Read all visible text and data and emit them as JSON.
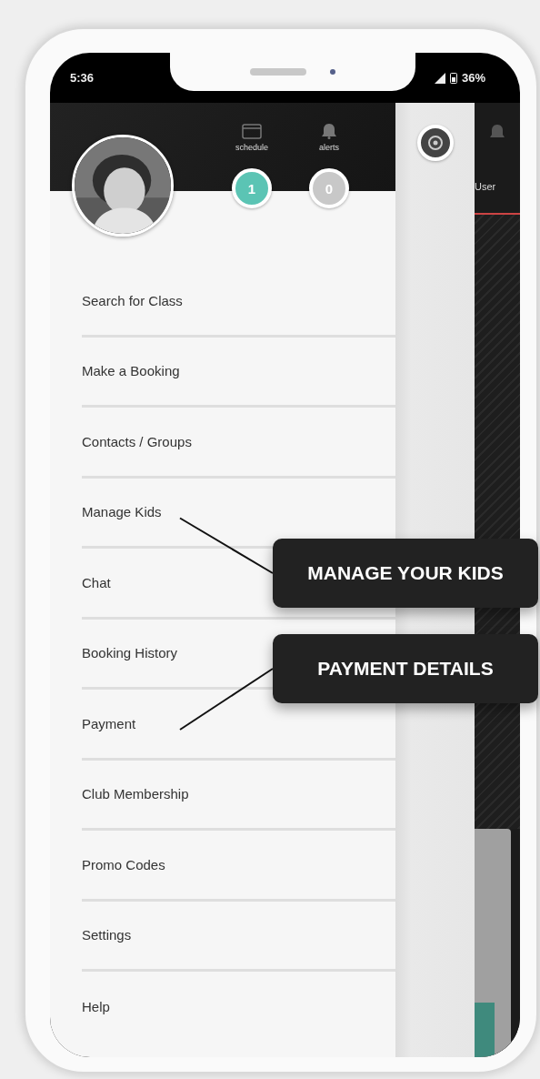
{
  "status_bar": {
    "time": "5:36",
    "battery": "36%"
  },
  "drawer": {
    "shortcuts": [
      {
        "kind": "schedule",
        "label": "schedule",
        "count": "1",
        "color": "#5bc4b4"
      },
      {
        "kind": "alerts",
        "label": "alerts",
        "count": "0",
        "color": "#c8c8c8"
      }
    ],
    "menu": [
      "Search for Class",
      "Make a Booking",
      "Contacts / Groups",
      "Manage Kids",
      "Chat",
      "Booking History",
      "Payment",
      "Club Membership",
      "Promo Codes",
      "Settings",
      "Help"
    ]
  },
  "main_app": {
    "tab_label": "User"
  },
  "callouts": [
    {
      "text": "MANAGE YOUR KIDS"
    },
    {
      "text": "PAYMENT DETAILS"
    }
  ]
}
